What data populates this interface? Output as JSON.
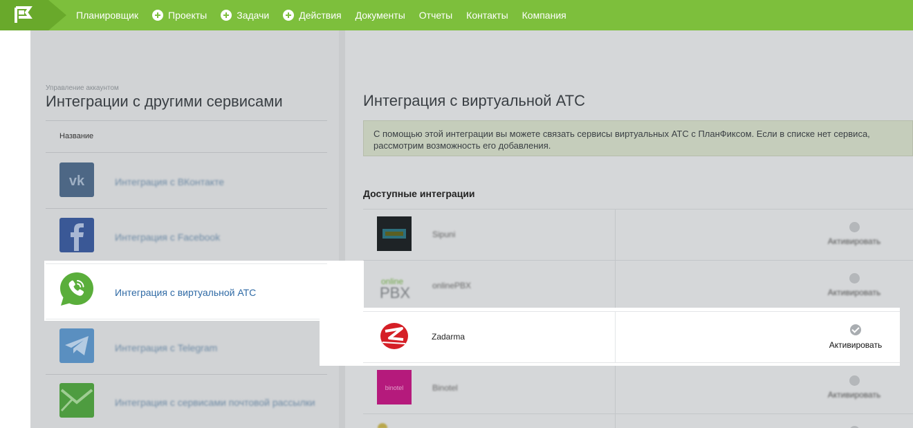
{
  "nav": {
    "items": [
      {
        "label": "Планировщик",
        "plus": false
      },
      {
        "label": "Проекты",
        "plus": true
      },
      {
        "label": "Задачи",
        "plus": true
      },
      {
        "label": "Действия",
        "plus": true
      },
      {
        "label": "Документы",
        "plus": false
      },
      {
        "label": "Отчеты",
        "plus": false
      },
      {
        "label": "Контакты",
        "plus": false
      },
      {
        "label": "Компания",
        "plus": false
      }
    ]
  },
  "left": {
    "breadcrumb": "Управление аккаунтом",
    "title": "Интеграции с другими сервисами",
    "column_header": "Название",
    "services": [
      {
        "label": "Интеграция с ВКонтакте",
        "icon": "vk-icon"
      },
      {
        "label": "Интеграция с Facebook",
        "icon": "facebook-icon"
      },
      {
        "label": "Интеграция с виртуальной АТС",
        "icon": "whatsapp-phone-icon",
        "selected": true
      },
      {
        "label": "Интеграция с Telegram",
        "icon": "telegram-icon"
      },
      {
        "label": "Интеграция с сервисами почтовой рассылки",
        "icon": "mail-icon"
      }
    ]
  },
  "right": {
    "title": "Интеграция с виртуальной АТС",
    "notice": "С помощью этой интеграции вы можете связать сервисы виртуальных АТС с ПланФиксом. Если в списке нет сервиса, рассмотрим возможность его добавления.",
    "available_title": "Доступные интеграции",
    "integrations": [
      {
        "name": "Sipuni",
        "action": "Активировать"
      },
      {
        "name": "onlinePBX",
        "action": "Активировать",
        "logo_text_top": "online",
        "logo_text_bottom": "PBX"
      },
      {
        "name": "Zadarma",
        "action": "Активировать",
        "highlighted": true
      },
      {
        "name": "Binotel",
        "action": "Активировать",
        "logo_text": "binotel"
      }
    ]
  },
  "colors": {
    "nav_green": "#7dbf3c",
    "link_blue": "#2f6aa5",
    "zadarma_red": "#d51f26"
  }
}
